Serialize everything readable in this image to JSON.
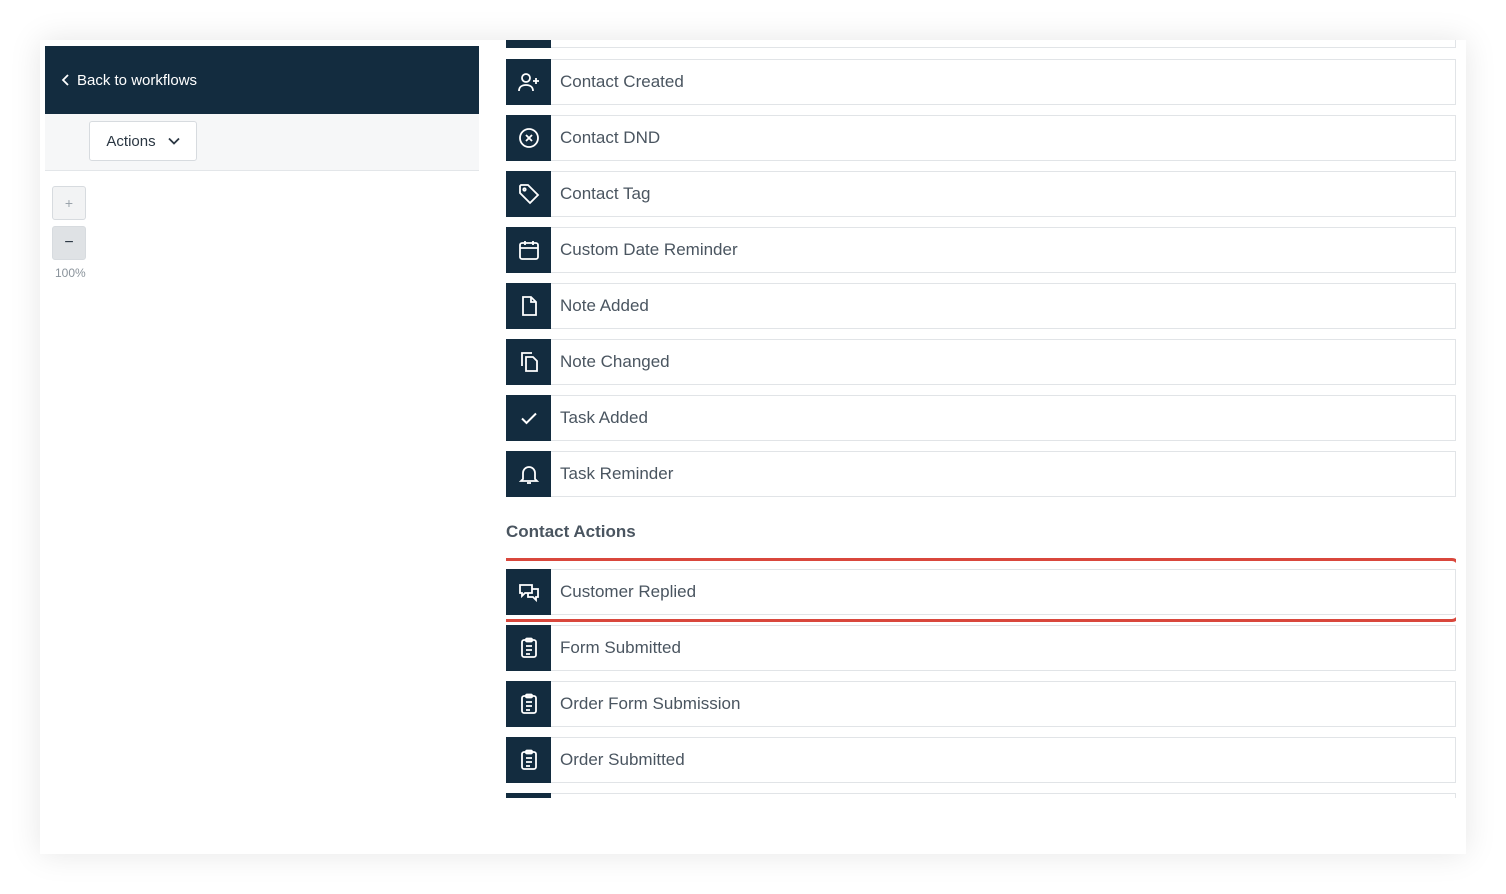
{
  "header": {
    "back_label": "Back to workflows"
  },
  "toolbar": {
    "actions_label": "Actions"
  },
  "zoom": {
    "plus": "+",
    "minus": "−",
    "level": "100%"
  },
  "triggers": [
    {
      "label": "Contact Created",
      "icon": "user-plus-icon"
    },
    {
      "label": "Contact DND",
      "icon": "x-circle-icon"
    },
    {
      "label": "Contact Tag",
      "icon": "tag-icon"
    },
    {
      "label": "Custom Date Reminder",
      "icon": "calendar-icon"
    },
    {
      "label": "Note Added",
      "icon": "document-icon"
    },
    {
      "label": "Note Changed",
      "icon": "documents-icon"
    },
    {
      "label": "Task Added",
      "icon": "check-icon"
    },
    {
      "label": "Task Reminder",
      "icon": "bell-icon"
    }
  ],
  "contact_actions": {
    "title": "Contact Actions",
    "items": [
      {
        "label": "Customer Replied",
        "icon": "chat-icon"
      },
      {
        "label": "Form Submitted",
        "icon": "clipboard-icon"
      },
      {
        "label": "Order Form Submission",
        "icon": "clipboard-icon"
      },
      {
        "label": "Order Submitted",
        "icon": "clipboard-icon"
      }
    ]
  },
  "colors": {
    "navy": "#132c3f",
    "highlight": "#d9473c"
  }
}
